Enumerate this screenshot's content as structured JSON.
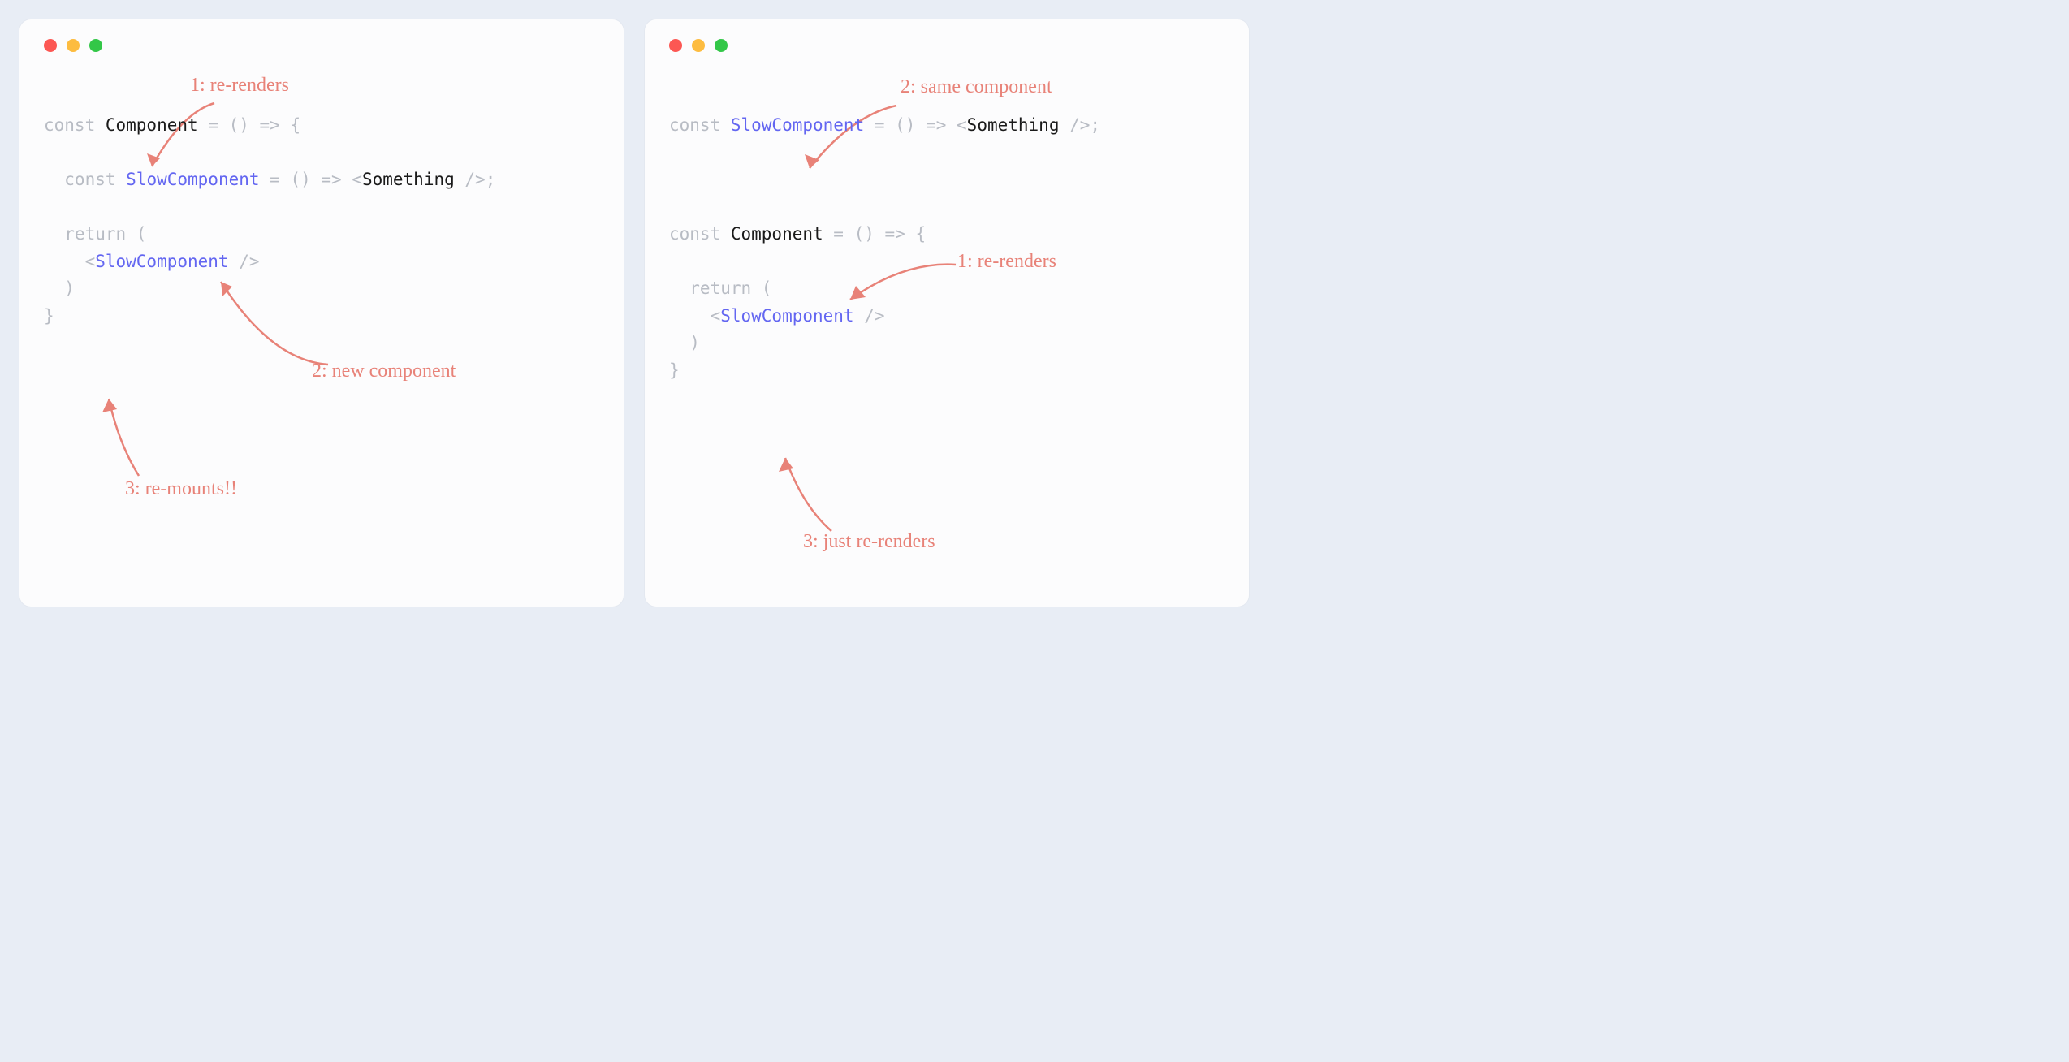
{
  "colors": {
    "background": "#e8edf5",
    "panel": "#fcfcfd",
    "annotation": "#e88278",
    "keyword": "#b8bcc4",
    "identifier": "#1a1a1a",
    "component": "#6366f1",
    "traffic_red": "#fc5753",
    "traffic_yellow": "#fdbc40",
    "traffic_green": "#33c748"
  },
  "left": {
    "annotations": {
      "a1": "1: re-renders",
      "a2": "2: new component",
      "a3": "3: re-mounts!!"
    },
    "code": {
      "l1_kw": "const ",
      "l1_id": "Component",
      "l1_rest": " = () => {",
      "l2_kw": "  const ",
      "l2_comp": "SlowComponent",
      "l2_rest1": " = () => <",
      "l2_id": "Something",
      "l2_rest2": " />;",
      "l3_kw": "  return (",
      "l4_open": "    <",
      "l4_comp": "SlowComponent",
      "l4_close": " />",
      "l5": "  )",
      "l6": "}"
    }
  },
  "right": {
    "annotations": {
      "a1": "1: re-renders",
      "a2": "2: same component",
      "a3": "3: just re-renders"
    },
    "code": {
      "l1_kw": "const ",
      "l1_comp": "SlowComponent",
      "l1_rest1": " = () => <",
      "l1_id": "Something",
      "l1_rest2": " />;",
      "l2_kw": "const ",
      "l2_id": "Component",
      "l2_rest": " = () => {",
      "l3_kw": "  return (",
      "l4_open": "    <",
      "l4_comp": "SlowComponent",
      "l4_close": " />",
      "l5": "  )",
      "l6": "}"
    }
  }
}
